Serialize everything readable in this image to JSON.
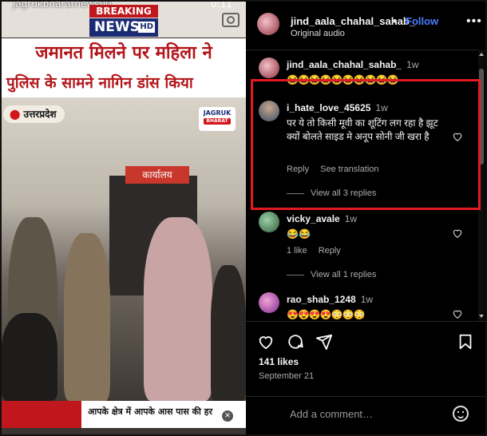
{
  "video": {
    "overlay_handle": "jagrukbharatnews00",
    "overlay_time": "0:11",
    "breaking_line1": "BREAKING",
    "breaking_line2": "NEWS",
    "breaking_hd": "HD",
    "headline_line1": "जमानत मिलने पर महिला ने",
    "headline_line2": "पुलिस के सामने नागिन डांस किया",
    "location": "उत्तरप्रदेश",
    "station_sign": "कार्यालय",
    "channel_logo": "JAGRUK",
    "channel_logo_sub": "BHARAT",
    "ticker_text": "आपके क्षेत्र में आपके आस पास की हर"
  },
  "post": {
    "username": "jind_aala_chahal_sahab_",
    "separator": "•",
    "follow_label": "Follow",
    "audio": "Original audio",
    "more_icon": "more-options-icon"
  },
  "comments": [
    {
      "username": "jind_aala_chahal_sahab_",
      "time": "1w",
      "text": "😂😂😂😂😂😂😂😂😂😂"
    },
    {
      "username": "i_hate_love_45625",
      "time": "1w",
      "text": "पर ये तो किसी मूवी का शूटिंग लग रहा है झूट क्यों बोलते साइड मे अनूप सोनी जी खरा है",
      "reply_label": "Reply",
      "translate_label": "See translation",
      "view_replies": "View all 3 replies"
    },
    {
      "username": "vicky_avale",
      "time": "1w",
      "text": "😂😂",
      "likes": "1 like",
      "reply_label": "Reply",
      "view_replies": "View all 1 replies"
    },
    {
      "username": "rao_shab_1248",
      "time": "1w",
      "text": "😍😍😍😍😳😳😳"
    }
  ],
  "actions": {
    "likes": "141 likes",
    "date": "September 21",
    "add_comment_placeholder": "Add a comment…"
  },
  "colors": {
    "accent_blue": "#4a7dff",
    "highlight_red": "#e21b22",
    "panel_bg": "#000000"
  }
}
